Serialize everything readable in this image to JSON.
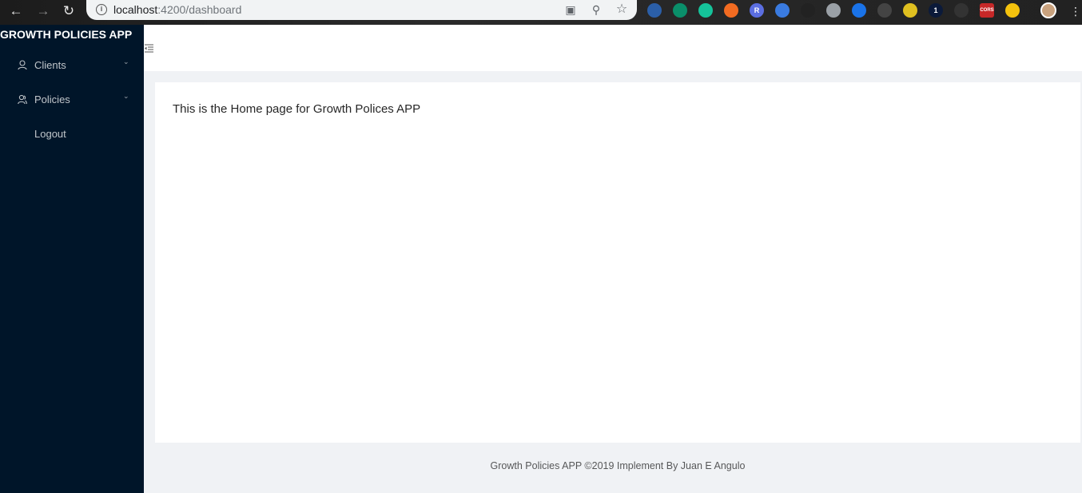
{
  "browser": {
    "url_host": "localhost",
    "url_path": ":4200/dashboard",
    "extensions": [
      {
        "name": "ext-1-icon",
        "glyph": "",
        "color": "#2b5fa8"
      },
      {
        "name": "ext-2-icon",
        "glyph": "",
        "color": "#0a8f6a"
      },
      {
        "name": "grammarly-icon",
        "glyph": "",
        "color": "#15c39a"
      },
      {
        "name": "ext-4-icon",
        "glyph": "",
        "color": "#f26b21"
      },
      {
        "name": "ext-5-icon",
        "glyph": "R",
        "color": "#5b6ee1"
      },
      {
        "name": "ext-6-icon",
        "glyph": "",
        "color": "#3a7be0"
      },
      {
        "name": "react-devtools-icon",
        "glyph": "",
        "color": "#222"
      },
      {
        "name": "ext-8-icon",
        "glyph": "",
        "color": "#9aa0a6"
      },
      {
        "name": "ext-9-icon",
        "glyph": "",
        "color": "#1a73e8"
      },
      {
        "name": "ext-10-icon",
        "glyph": "",
        "color": "#444"
      },
      {
        "name": "ext-11-icon",
        "glyph": "",
        "color": "#e0c020"
      },
      {
        "name": "ext-12-icon",
        "glyph": "1",
        "color": "#0b1a3a"
      },
      {
        "name": "ext-13-icon",
        "glyph": "",
        "color": "#333"
      },
      {
        "name": "cors-icon",
        "glyph": "CORS",
        "color": "#c62828"
      },
      {
        "name": "ext-15-icon",
        "glyph": "",
        "color": "#f4c20d"
      }
    ]
  },
  "app": {
    "title": "GROWTH POLICIES APP",
    "menu": [
      {
        "label": "Clients",
        "icon": "user-icon",
        "has_submenu": true
      },
      {
        "label": "Policies",
        "icon": "team-icon",
        "has_submenu": true
      },
      {
        "label": "Logout",
        "icon": "",
        "has_submenu": false
      }
    ]
  },
  "content": {
    "text": "This is the Home page for Growth Polices APP"
  },
  "footer": {
    "text": "Growth Policies APP ©2019 Implement By Juan E Angulo"
  },
  "colors": {
    "sidebar_bg": "#001529",
    "layout_bg": "#f0f2f5"
  }
}
